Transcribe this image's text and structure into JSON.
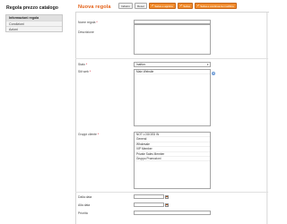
{
  "sidebar": {
    "title": "Regola prezzo catalogo",
    "tabs": [
      {
        "label": "Informazioni regola",
        "active": true
      },
      {
        "label": "Condizioni",
        "active": false
      },
      {
        "label": "Azioni",
        "active": false
      }
    ]
  },
  "header": {
    "title": "Nuova regola",
    "buttons": [
      {
        "label": "Indietro",
        "style": "gray"
      },
      {
        "label": "Reset",
        "style": "gray"
      },
      {
        "label": "Salva e applica",
        "style": "orange"
      },
      {
        "label": "Salva",
        "style": "orange"
      },
      {
        "label": "Salva e continua la modifica",
        "style": "orange"
      }
    ]
  },
  "form": {
    "rule_name": {
      "label": "Nome regola",
      "required": true,
      "value": ""
    },
    "description": {
      "label": "Descrizione",
      "value": ""
    },
    "status": {
      "label": "Stato",
      "required": true,
      "value": "Inattivo"
    },
    "websites": {
      "label": "Siti web",
      "required": true,
      "options": [
        "Main Website"
      ],
      "selected": []
    },
    "customer_groups": {
      "label": "Gruppi cliente",
      "required": true,
      "options": [
        "NOT LOGGED IN",
        "General",
        "Wholesale",
        "VIP Member",
        "Private Sales Member",
        "Gruppo Promozioni"
      ],
      "selected": []
    },
    "from_date": {
      "label": "Dalla data",
      "value": ""
    },
    "to_date": {
      "label": "Alla data",
      "value": ""
    },
    "priority": {
      "label": "Priorità",
      "value": ""
    }
  },
  "colors": {
    "accent": "#e35f16",
    "button_orange": "#f18b2c",
    "required": "#d1001b"
  },
  "icons": {
    "help": "help-icon",
    "calendar": "calendar-icon",
    "select_caret": "chevron-down-icon"
  }
}
